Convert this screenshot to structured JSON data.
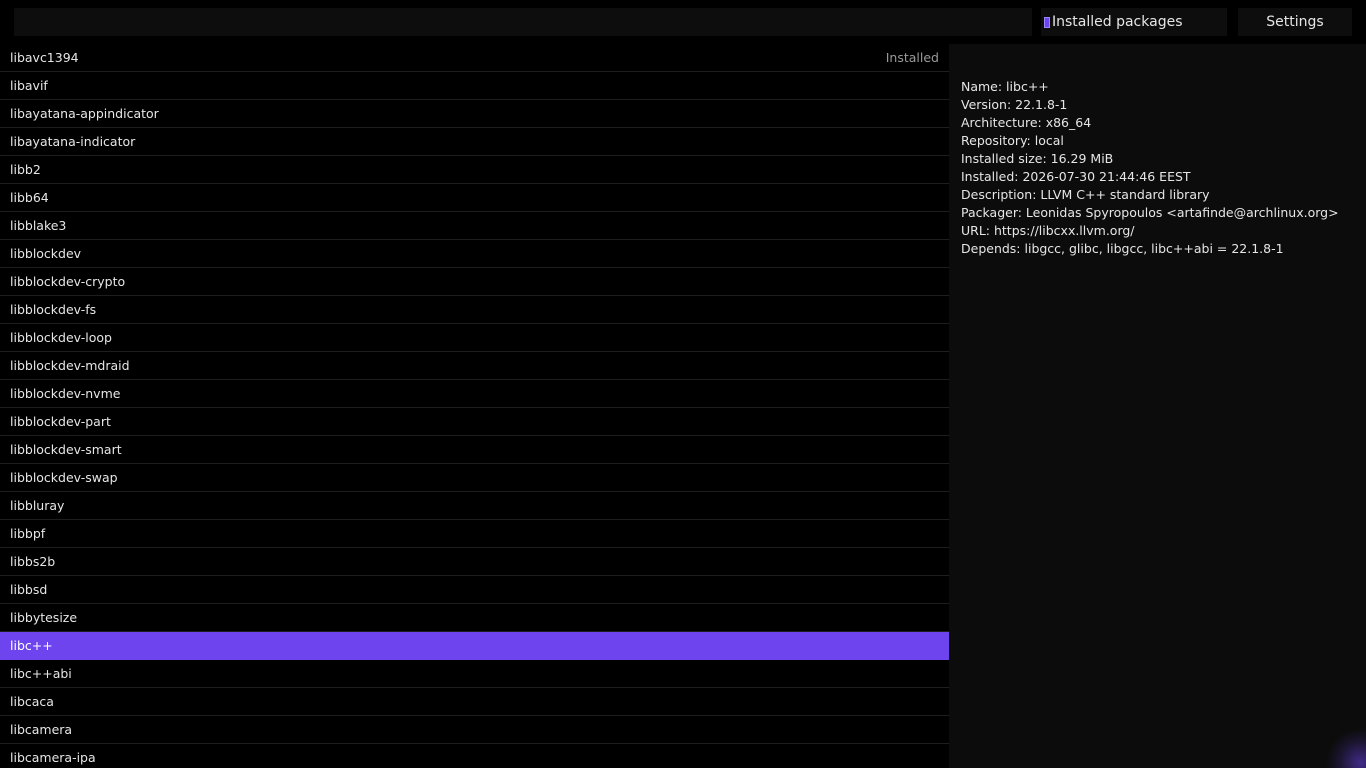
{
  "search": {
    "value": "",
    "placeholder": ""
  },
  "toolbar": {
    "installed_toggle_label": "Installed packages",
    "installed_toggle_checked": true,
    "settings_label": "Settings"
  },
  "colors": {
    "accent": "#6d44ee",
    "background": "#000000",
    "panel": "#0c0c0c"
  },
  "packages": [
    {
      "name": "libavc1394",
      "status": "Installed"
    },
    {
      "name": "libavif",
      "status": ""
    },
    {
      "name": "libayatana-appindicator",
      "status": ""
    },
    {
      "name": "libayatana-indicator",
      "status": ""
    },
    {
      "name": "libb2",
      "status": ""
    },
    {
      "name": "libb64",
      "status": ""
    },
    {
      "name": "libblake3",
      "status": ""
    },
    {
      "name": "libblockdev",
      "status": ""
    },
    {
      "name": "libblockdev-crypto",
      "status": ""
    },
    {
      "name": "libblockdev-fs",
      "status": ""
    },
    {
      "name": "libblockdev-loop",
      "status": ""
    },
    {
      "name": "libblockdev-mdraid",
      "status": ""
    },
    {
      "name": "libblockdev-nvme",
      "status": ""
    },
    {
      "name": "libblockdev-part",
      "status": ""
    },
    {
      "name": "libblockdev-smart",
      "status": ""
    },
    {
      "name": "libblockdev-swap",
      "status": ""
    },
    {
      "name": "libbluray",
      "status": ""
    },
    {
      "name": "libbpf",
      "status": ""
    },
    {
      "name": "libbs2b",
      "status": ""
    },
    {
      "name": "libbsd",
      "status": ""
    },
    {
      "name": "libbytesize",
      "status": ""
    },
    {
      "name": "libc++",
      "status": "",
      "selected": true
    },
    {
      "name": "libc++abi",
      "status": ""
    },
    {
      "name": "libcaca",
      "status": ""
    },
    {
      "name": "libcamera",
      "status": ""
    },
    {
      "name": "libcamera-ipa",
      "status": ""
    }
  ],
  "details": {
    "name": "Name: libc++",
    "version": "Version: 22.1.8-1",
    "architecture": "Architecture: x86_64",
    "repository": "Repository: local",
    "installed_size": "Installed size: 16.29 MiB",
    "installed": "Installed: 2026-07-30 21:44:46 EEST",
    "description": "Description: LLVM C++ standard library",
    "packager": "Packager: Leonidas Spyropoulos <artafinde@archlinux.org>",
    "url": "URL: https://libcxx.llvm.org/",
    "depends": "Depends: libgcc, glibc, libgcc, libc++abi = 22.1.8-1"
  }
}
